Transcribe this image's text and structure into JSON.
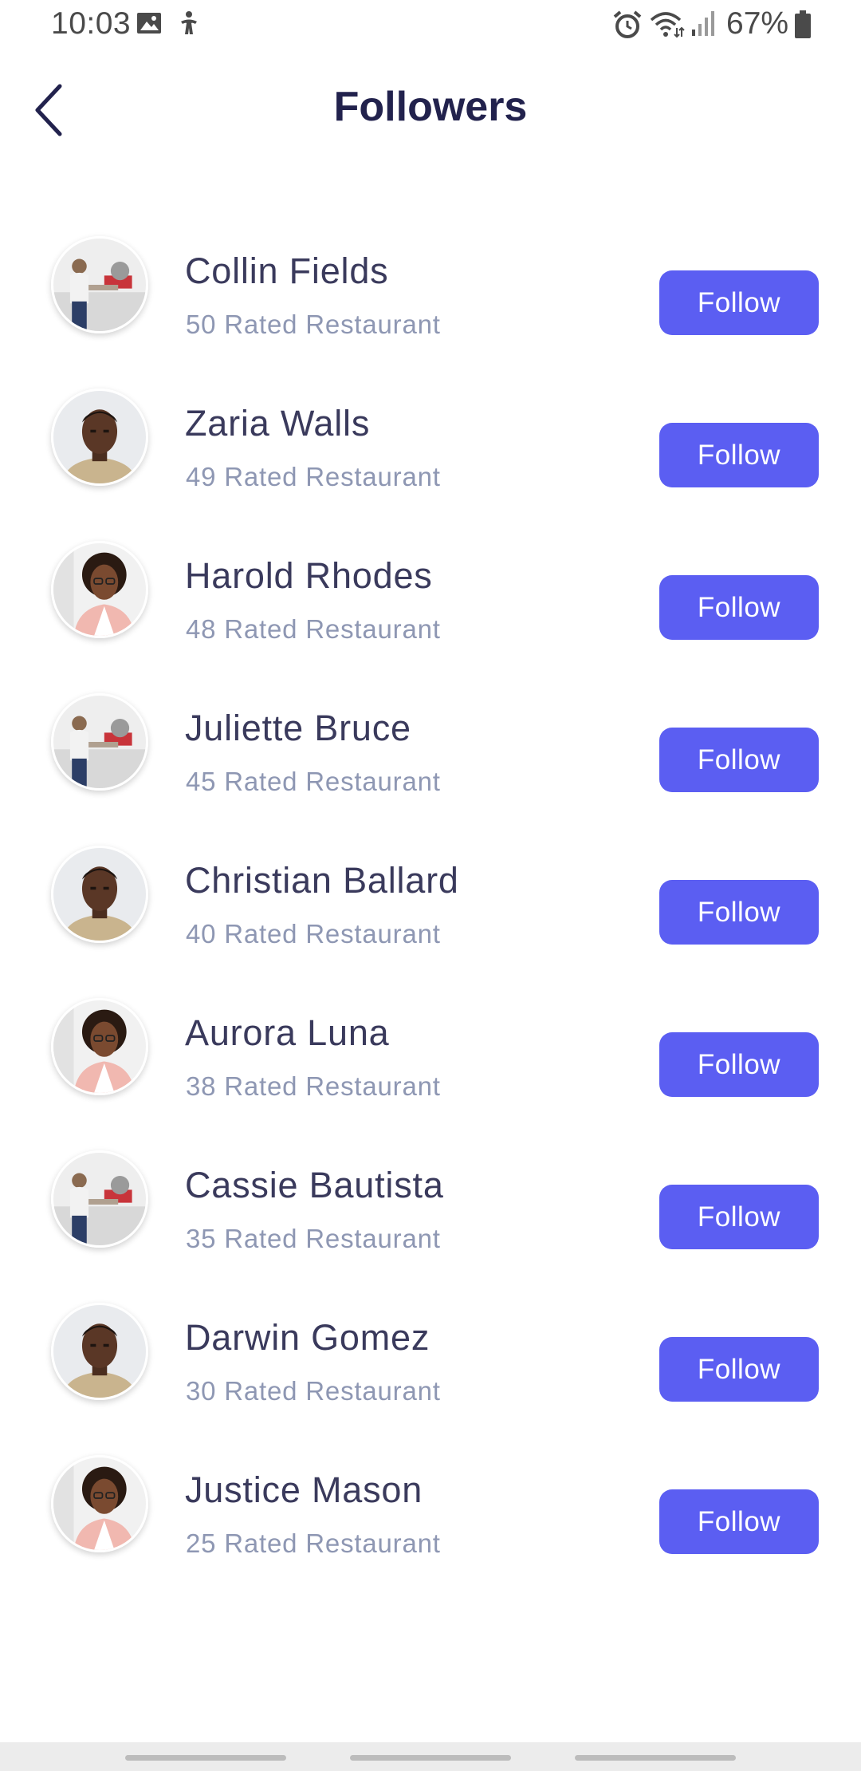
{
  "status_bar": {
    "time": "10:03",
    "battery": "67%",
    "icons": [
      "gallery-icon",
      "accessibility-icon",
      "alarm-icon",
      "wifi-icon",
      "signal-icon",
      "battery-icon"
    ]
  },
  "header": {
    "title": "Followers",
    "back_icon": "chevron-left-icon"
  },
  "followers": [
    {
      "name": "Collin Fields",
      "subtitle": "50 Rated Restaurant",
      "button": "Follow",
      "avatar": "workshop"
    },
    {
      "name": "Zaria Walls",
      "subtitle": "49 Rated Restaurant",
      "button": "Follow",
      "avatar": "man"
    },
    {
      "name": "Harold Rhodes",
      "subtitle": "48 Rated Restaurant",
      "button": "Follow",
      "avatar": "woman"
    },
    {
      "name": "Juliette Bruce",
      "subtitle": "45 Rated Restaurant",
      "button": "Follow",
      "avatar": "workshop"
    },
    {
      "name": "Christian Ballard",
      "subtitle": "40 Rated Restaurant",
      "button": "Follow",
      "avatar": "man"
    },
    {
      "name": "Aurora Luna",
      "subtitle": "38 Rated Restaurant",
      "button": "Follow",
      "avatar": "woman"
    },
    {
      "name": "Cassie Bautista",
      "subtitle": "35 Rated Restaurant",
      "button": "Follow",
      "avatar": "workshop"
    },
    {
      "name": "Darwin Gomez",
      "subtitle": "30 Rated Restaurant",
      "button": "Follow",
      "avatar": "man"
    },
    {
      "name": "Justice Mason",
      "subtitle": "25 Rated Restaurant",
      "button": "Follow",
      "avatar": "woman"
    }
  ],
  "colors": {
    "accent": "#5b5ef2",
    "title": "#22224d",
    "name": "#3a3a5c",
    "subtitle": "#8e97b3"
  }
}
